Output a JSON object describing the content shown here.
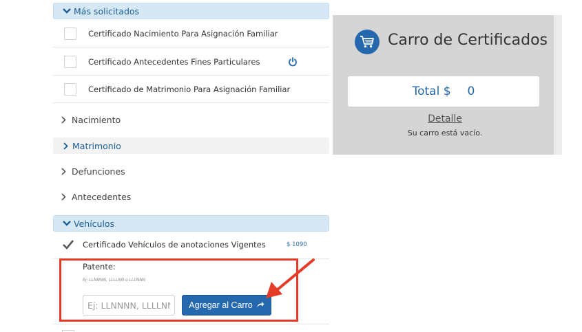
{
  "categories": {
    "most_requested": "Más solicitados",
    "nacimiento": "Nacimiento",
    "matrimonio": "Matrimonio",
    "defunciones": "Defunciones",
    "antecedentes": "Antecedentes",
    "vehiculos": "Vehículos"
  },
  "most_requested_items": [
    {
      "label": "Certificado Nacimiento Para Asignación Familiar",
      "checked": false
    },
    {
      "label": "Certificado Antecedentes Fines Particulares",
      "checked": false,
      "icon": "power-icon"
    },
    {
      "label": "Certificado de Matrimonio Para Asignación Familiar",
      "checked": false
    }
  ],
  "vehicle_item": {
    "label": "Certificado Vehículos de anotaciones Vigentes",
    "price": "$ 1090",
    "checked": true
  },
  "patente": {
    "label": "Patente:",
    "hint": "Ej: LLNNNN, LLLLNN o LLLNNN",
    "placeholder": "Ej: LLNNNN, LLLLNN o LLLNNN",
    "button_label": "Agregar al Carro"
  },
  "cart": {
    "title": "Carro de Certificados",
    "total_label": "Total $",
    "total_value": "0",
    "detail_link": "Detalle",
    "empty_message": "Su carro está vacío."
  },
  "colors": {
    "accent": "#2568ad",
    "header_bg": "#d6e8f4",
    "annotation": "#e53b27",
    "cart_bg": "#d5d5d5"
  }
}
